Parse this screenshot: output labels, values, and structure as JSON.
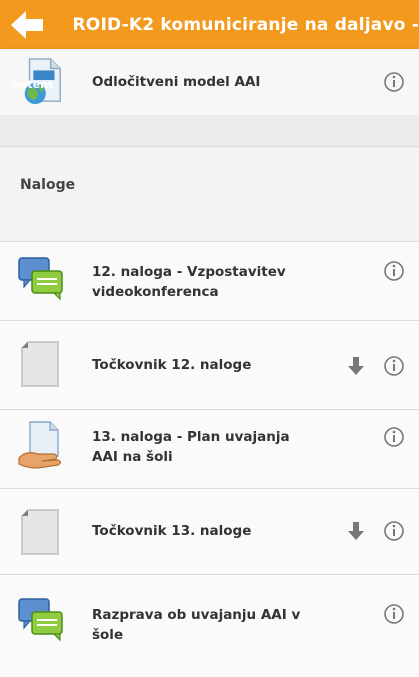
{
  "appbar": {
    "title": "ROID-K2 komuniciranje na daljavo -",
    "back_icon": "arrow-left-icon",
    "color": "#f39a1e"
  },
  "top_item": {
    "label": "Odločitveni model AAI",
    "icon": "web-page-icon",
    "icon_text": "ontent"
  },
  "section": {
    "title": "Naloge"
  },
  "items": [
    {
      "label_line1": "12. naloga - Vzpostavitev",
      "label_line2": "videokonferenca",
      "icon": "chat-bubbles-icon"
    },
    {
      "label_line1": "Točkovnik 12. naloge",
      "label_line2": "",
      "icon": "file-icon",
      "download": true
    },
    {
      "label_line1": "13. naloga - Plan uvajanja",
      "label_line2": "AAI na šoli",
      "icon": "assignment-hand-icon"
    },
    {
      "label_line1": "Točkovnik 13. naloge",
      "label_line2": "",
      "icon": "file-icon",
      "download": true
    },
    {
      "label_line1": "Razprava ob uvajanju AAI v",
      "label_line2": "šole",
      "icon": "chat-bubbles-icon"
    }
  ],
  "info_icon": "info-circle-icon",
  "download_icon": "download-arrow-icon"
}
